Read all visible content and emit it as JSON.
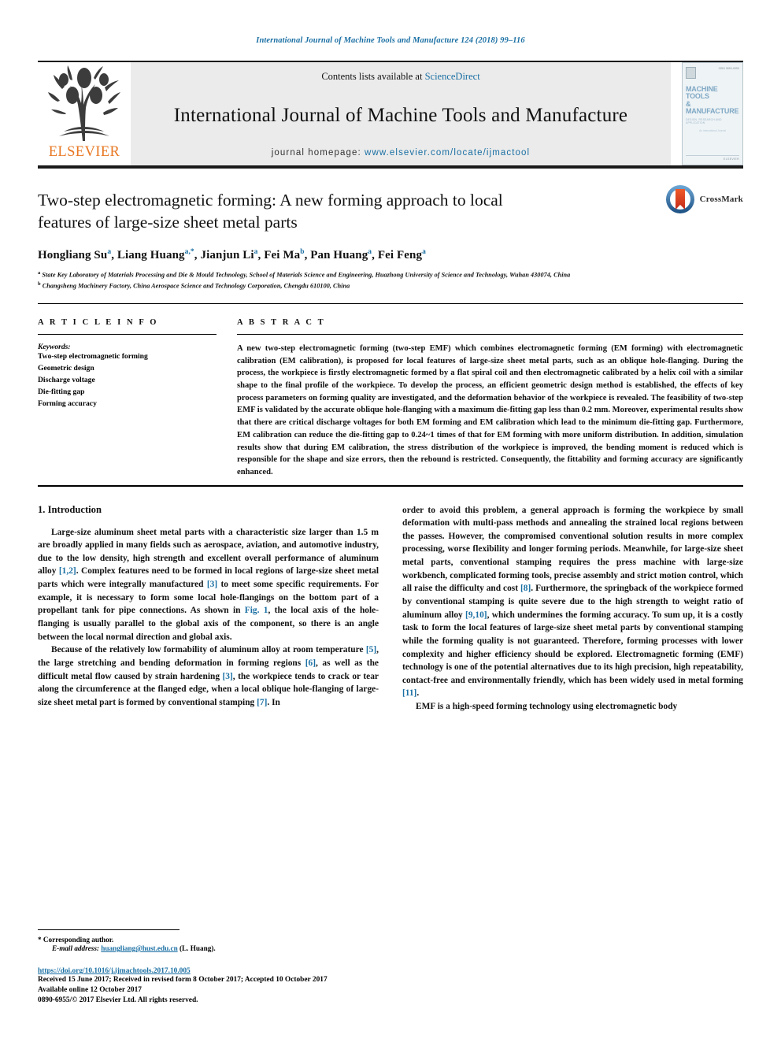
{
  "running_head": "International Journal of Machine Tools and Manufacture 124 (2018) 99–116",
  "masthead": {
    "contents_prefix": "Contents lists available at ",
    "sciencedirect": "ScienceDirect",
    "journal_title": "International Journal of Machine Tools and Manufacture",
    "homepage_prefix": "journal homepage: ",
    "homepage_url": "www.elsevier.com/locate/ijmactool",
    "publisher": "ELSEVIER",
    "cover": {
      "issn": "ISSN 0890-6955",
      "title_line1": "MACHINE TOOLS",
      "title_line2": "& MANUFACTURE",
      "subtitle": "DESIGN, RESEARCH AND APPLICATION",
      "mid_text": "An International Journal",
      "foot_text": "ELSEVIER"
    },
    "accent_blue": "#1a6fa3",
    "accent_orange": "#e87722"
  },
  "article": {
    "title": "Two-step electromagnetic forming: A new forming approach to local features of large-size sheet metal parts",
    "crossmark_label": "CrossMark",
    "authors": [
      {
        "name": "Hongliang Su",
        "sup": "a"
      },
      {
        "name": "Liang Huang",
        "sup": "a,*"
      },
      {
        "name": "Jianjun Li",
        "sup": "a"
      },
      {
        "name": "Fei Ma",
        "sup": "b"
      },
      {
        "name": "Pan Huang",
        "sup": "a"
      },
      {
        "name": "Fei Feng",
        "sup": "a"
      }
    ],
    "affiliations": [
      {
        "sup": "a",
        "text": "State Key Laboratory of Materials Processing and Die & Mould Technology, School of Materials Science and Engineering, Huazhong University of Science and Technology, Wuhan 430074, China"
      },
      {
        "sup": "b",
        "text": "Changsheng Machinery Factory, China Aerospace Science and Technology Corporation, Chengdu 610100, China"
      }
    ]
  },
  "article_info": {
    "heading": "A R T I C L E   I N F O",
    "keywords_label": "Keywords:",
    "keywords": [
      "Two-step electromagnetic forming",
      "Geometric design",
      "Discharge voltage",
      "Die-fitting gap",
      "Forming accuracy"
    ]
  },
  "abstract": {
    "heading": "A B S T R A C T",
    "text": "A new two-step electromagnetic forming (two-step EMF) which combines electromagnetic forming (EM forming) with electromagnetic calibration (EM calibration), is proposed for local features of large-size sheet metal parts, such as an oblique hole-flanging. During the process, the workpiece is firstly electromagnetic formed by a flat spiral coil and then electromagnetic calibrated by a helix coil with a similar shape to the final profile of the workpiece. To develop the process, an efficient geometric design method is established, the effects of key process parameters on forming quality are investigated, and the deformation behavior of the workpiece is revealed. The feasibility of two-step EMF is validated by the accurate oblique hole-flanging with a maximum die-fitting gap less than 0.2 mm. Moreover, experimental results show that there are critical discharge voltages for both EM forming and EM calibration which lead to the minimum die-fitting gap. Furthermore, EM calibration can reduce the die-fitting gap to 0.24~1 times of that for EM forming with more uniform distribution. In addition, simulation results show that during EM calibration, the stress distribution of the workpiece is improved, the bending moment is reduced which is responsible for the shape and size errors, then the rebound is restricted. Consequently, the fittability and forming accuracy are significantly enhanced."
  },
  "body": {
    "section_title": "1.  Introduction",
    "left_paragraphs": [
      "Large-size aluminum sheet metal parts with a characteristic size larger than 1.5 m are broadly applied in many fields such as aerospace, aviation, and automotive industry, due to the low density, high strength and excellent overall performance of aluminum alloy [1,2]. Complex features need to be formed in local regions of large-size sheet metal parts which were integrally manufactured [3] to meet some specific requirements. For example, it is necessary to form some local hole-flangings on the bottom part of a propellant tank for pipe connections. As shown in Fig. 1, the local axis of the hole-flanging is usually parallel to the global axis of the component, so there is an angle between the local normal direction and global axis.",
      "Because of the relatively low formability of aluminum alloy at room temperature [5], the large stretching and bending deformation in forming regions [6], as well as the difficult metal flow caused by strain hardening [3], the workpiece tends to crack or tear along the circumference at the flanged edge, when a local oblique hole-flanging of large-size sheet metal part is formed by conventional stamping [7]. In"
    ],
    "right_paragraphs": [
      "order to avoid this problem, a general approach is forming the workpiece by small deformation with multi-pass methods and annealing the strained local regions between the passes. However, the compromised conventional solution results in more complex processing, worse flexibility and longer forming periods. Meanwhile, for large-size sheet metal parts, conventional stamping requires the press machine with large-size workbench, complicated forming tools, precise assembly and strict motion control, which all raise the difficulty and cost [8]. Furthermore, the springback of the workpiece formed by conventional stamping is quite severe due to the high strength to weight ratio of aluminum alloy [9,10], which undermines the forming accuracy. To sum up, it is a costly task to form the local features of large-size sheet metal parts by conventional stamping while the forming quality is not guaranteed. Therefore, forming processes with lower complexity and higher efficiency should be explored. Electromagnetic forming (EMF) technology is one of the potential alternatives due to its high precision, high repeatability, contact-free and environmentally friendly, which has been widely used in metal forming [11].",
      "EMF is a high-speed forming technology using electromagnetic body"
    ]
  },
  "footer": {
    "corresponding": "*  Corresponding author.",
    "email_label": "E-mail address:",
    "email": "huangliang@hust.edu.cn",
    "email_suffix": "(L. Huang).",
    "doi": "https://doi.org/10.1016/j.ijmachtools.2017.10.005",
    "received": "Received 15 June 2017; Received in revised form 8 October 2017; Accepted 10 October 2017",
    "available": "Available online 12 October 2017",
    "copyright": "0890-6955/© 2017 Elsevier Ltd. All rights reserved."
  }
}
